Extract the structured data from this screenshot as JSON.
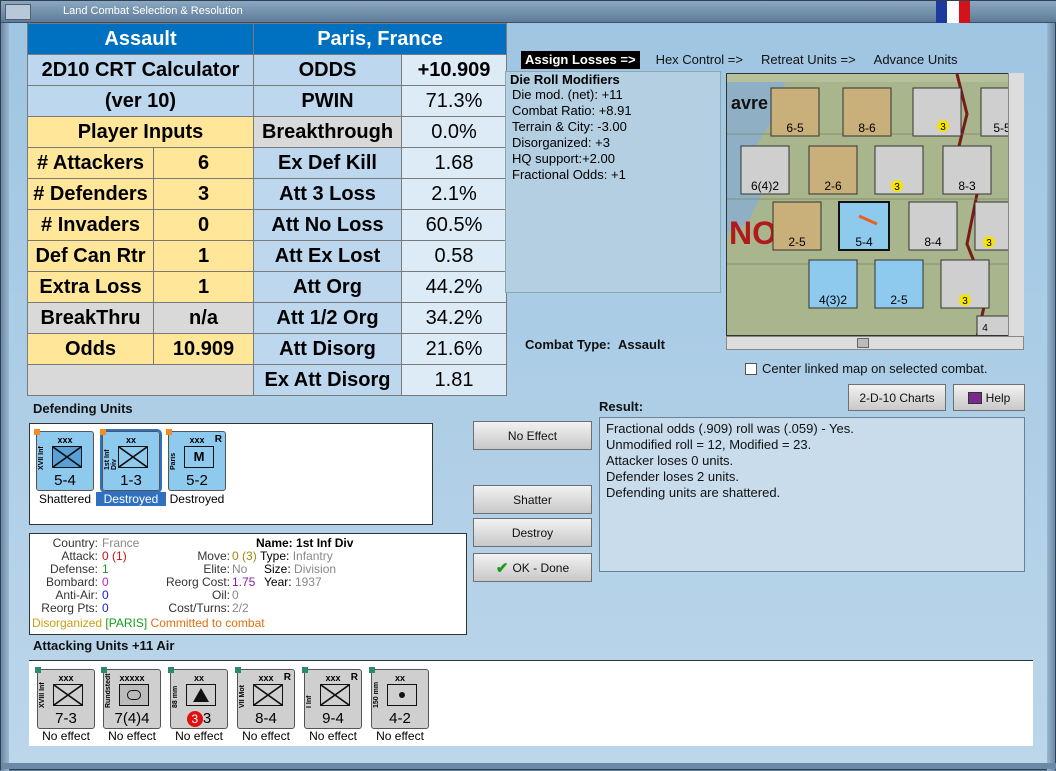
{
  "window": {
    "title": "Land Combat Selection & Resolution",
    "colors": {
      "frame": "#6c8aa6",
      "panel": "#b5cfe2",
      "calc_blue": "#0070c0",
      "calc_orange": "#ffe699",
      "calc_label": "#bdd7ee",
      "calc_value": "#ddebf7"
    }
  },
  "calc": {
    "header_left": "Assault",
    "header_right": "Paris, France",
    "title1": "2D10 CRT Calculator",
    "title2": "(ver 10)",
    "player_inputs": "Player Inputs",
    "inputs": [
      {
        "label": "# Attackers",
        "value": "6"
      },
      {
        "label": "# Defenders",
        "value": "3"
      },
      {
        "label": "# Invaders",
        "value": "0"
      },
      {
        "label": "Def Can Rtr",
        "value": "1"
      },
      {
        "label": "Extra Loss",
        "value": "1"
      },
      {
        "label": "BreakThru",
        "value": "n/a"
      },
      {
        "label": "Odds",
        "value": "10.909"
      }
    ],
    "results": [
      {
        "label": "ODDS",
        "value": "+10.909"
      },
      {
        "label": "PWIN",
        "value": "71.3%"
      },
      {
        "label": "Breakthrough",
        "value": "0.0%"
      },
      {
        "label": "Ex Def Kill",
        "value": "1.68"
      },
      {
        "label": "Att 3 Loss",
        "value": "2.1%"
      },
      {
        "label": "Att No Loss",
        "value": "60.5%"
      },
      {
        "label": "Att Ex Lost",
        "value": "0.58"
      },
      {
        "label": "Att Org",
        "value": "44.2%"
      },
      {
        "label": "Att 1/2 Org",
        "value": "34.2%"
      },
      {
        "label": "Att Disorg",
        "value": "21.6%"
      },
      {
        "label": "Ex Att Disorg",
        "value": "1.81"
      }
    ]
  },
  "steps": [
    "Assign Losses =>",
    "Hex Control =>",
    "Retreat Units =>",
    "Advance Units"
  ],
  "mods": {
    "title": "Die Roll Modifiers",
    "lines": [
      "Die mod. (net): +11",
      "",
      "Combat Ratio: +8.91",
      "Terrain & City: -3.00",
      "Disorganized: +3",
      "HQ support:+2.00",
      "Fractional Odds: +1"
    ]
  },
  "map": {
    "labels": [
      "avre",
      "NO"
    ],
    "units": [
      {
        "name": "XI Inf",
        "str": "6-5"
      },
      {
        "name": "XXII Mech",
        "str": "8-6"
      },
      {
        "name": "Bf 109 Emil",
        "str": "3"
      },
      {
        "name": "Lehr Div",
        "str": "5-5"
      },
      {
        "name": "Gendarmerie",
        "str": "6(4)2"
      },
      {
        "name": "10th Mech",
        "str": "2-6"
      },
      {
        "name": "Bf 109 Emil",
        "str": "3"
      },
      {
        "name": "IX Inf",
        "str": "8-3"
      },
      {
        "name": "10th Mech",
        "str": "2-5"
      },
      {
        "name": "XVII Inf",
        "str": "5-4"
      },
      {
        "name": "XX",
        "str": "8-4"
      },
      {
        "name": "Bf 109 Emil",
        "str": "3"
      },
      {
        "name": "Georges",
        "str": "4(3)2"
      },
      {
        "name": "1st Mech",
        "str": "2-5"
      },
      {
        "name": "Bf 109 Emil",
        "str": "3"
      },
      {
        "name": "",
        "str": "4"
      }
    ]
  },
  "combat_type_label": "Combat Type:",
  "combat_type": "Assault",
  "center_link": "Center linked map on selected combat.",
  "buttons": {
    "charts": "2-D-10 Charts",
    "help": "Help",
    "no_effect": "No Effect",
    "shatter": "Shatter",
    "destroy": "Destroy",
    "ok": "OK - Done"
  },
  "defending": {
    "title": "Defending Units",
    "units": [
      {
        "size": "xxx",
        "name": "XVII Inf",
        "str": "5-4",
        "caption": "Shattered",
        "color": "#8ec9ee",
        "r": ""
      },
      {
        "size": "xx",
        "name": "1st Inf Div",
        "str": "1-3",
        "caption": "Destroyed",
        "color": "#8ec9ee",
        "r": ""
      },
      {
        "size": "xxx",
        "name": "Paris",
        "str": "5-2",
        "caption": "Destroyed",
        "color": "#8ec9ee",
        "r": "R"
      }
    ]
  },
  "info": {
    "country_k": "Country:",
    "country": "France",
    "attack_k": "Attack:",
    "attack": "0",
    "attack2": "(1)",
    "defense_k": "Defense:",
    "defense": "1",
    "bombard_k": "Bombard:",
    "bombard": "0",
    "antiair_k": "Anti-Air:",
    "antiair": "0",
    "reorg_k": "Reorg Pts:",
    "reorg": "0",
    "name_k": "Name:",
    "name": "1st Inf Div",
    "move_k": "Move:",
    "move": "0",
    "move2": "(3)",
    "type_k": "Type:",
    "type": "Infantry",
    "elite_k": "Elite:",
    "elite": "No",
    "size_k": "Size:",
    "size": "Division",
    "rcost_k": "Reorg Cost:",
    "rcost": "1.75",
    "year_k": "Year:",
    "year": "1937",
    "oil_k": "Oil:",
    "oil": "0",
    "cost_k": "Cost/Turns:",
    "cost": "2/2",
    "status1": "Disorganized",
    "status2": "[PARIS]",
    "status3": "Committed to combat"
  },
  "result": {
    "title": "Result:",
    "lines": [
      "Fractional odds (.909) roll was (.059)  - Yes.",
      "Unmodified roll = 12, Modified = 23.",
      "Attacker loses 0 units.",
      "Defender loses 2 units.",
      "Defending units are shattered."
    ]
  },
  "attacking": {
    "title": "Attacking Units +11 Air",
    "units": [
      {
        "size": "xxx",
        "name": "XVIII Inf",
        "str": "7-3",
        "caption": "No effect",
        "r": "",
        "sym": "inf"
      },
      {
        "size": "xxxxx",
        "name": "Rundstedt",
        "str": "7(4)4",
        "caption": "No effect",
        "r": "",
        "sym": "hq"
      },
      {
        "size": "xx",
        "name": "88 mm",
        "str": "3",
        "str_badge": "3",
        "caption": "No effect",
        "r": "",
        "sym": "art"
      },
      {
        "size": "xxx",
        "name": "VII Mot",
        "str": "8-4",
        "caption": "No effect",
        "r": "R",
        "sym": "inf"
      },
      {
        "size": "xxx",
        "name": "I Inf",
        "str": "9-4",
        "caption": "No effect",
        "r": "R",
        "sym": "inf"
      },
      {
        "size": "xx",
        "name": "150 mm",
        "str": "4-2",
        "caption": "No effect",
        "r": "",
        "sym": "arty"
      }
    ]
  }
}
